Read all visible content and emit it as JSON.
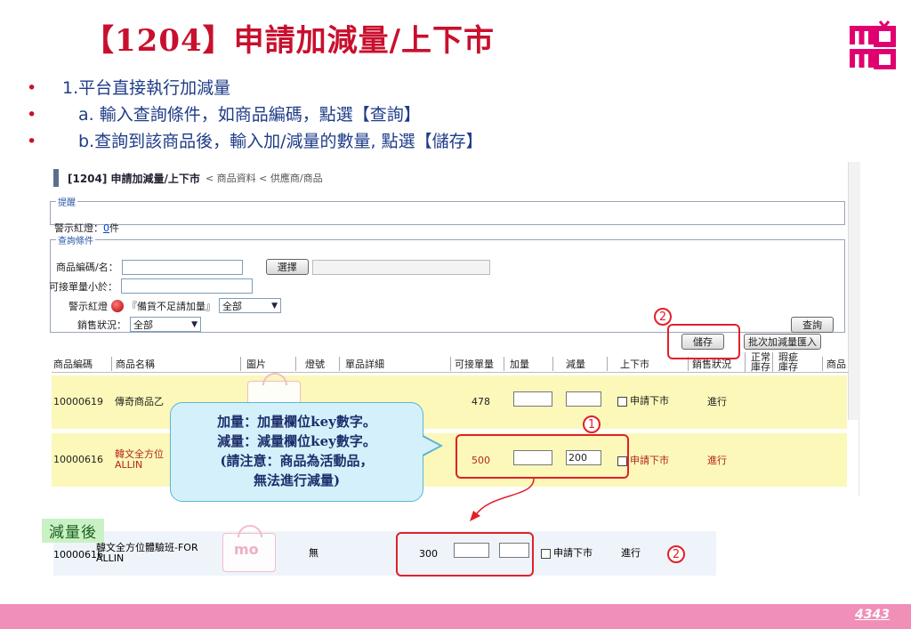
{
  "slide": {
    "title": "【1204】申請加減量/上下市",
    "logo_text": "momo",
    "page_number": "4343"
  },
  "bullets": [
    {
      "marker": "•",
      "text": "1.平台直接執行加減量"
    },
    {
      "marker": "•",
      "text": "a. 輸入查詢條件，如商品編碼，點選【查詢】"
    },
    {
      "marker": "•",
      "text": "b.查詢到該商品後，輸入加/減量的數量, 點選【儲存】"
    }
  ],
  "screen": {
    "title": "[1204] 申請加減量/上下市",
    "breadcrumb": "< 商品資料 < 供應商/商品",
    "remind": {
      "legend": "提醒",
      "label": "警示紅燈：",
      "count": "0",
      "unit": "件"
    },
    "query": {
      "legend": "查詢條件",
      "product_label": "商品編碼/名：",
      "select_button": "選擇",
      "qty_label": "可接單量小於：",
      "warn_label": "警示紅燈",
      "warn_note": "『備貨不足請加量』",
      "warn_select": "全部",
      "sales_label": "銷售狀況：",
      "sales_select": "全部",
      "query_button": "查詢"
    },
    "actions": {
      "save_button": "儲存",
      "batch_button": "批次加減量匯入"
    },
    "columns": [
      "商品編碼",
      "商品名稱",
      "圖片",
      "燈號",
      "單品詳細",
      "可接單量",
      "加量",
      "減量",
      "上下市",
      "銷售狀況",
      "正常庫存",
      "瑕疵庫存",
      "商品"
    ],
    "rows": [
      {
        "code": "10000619",
        "name": "傳奇商品乙",
        "qty": "478",
        "add": "",
        "sub": "",
        "delist": "申請下市",
        "status": "進行"
      },
      {
        "code": "10000616",
        "name": "韓文全方位",
        "name2": "ALLIN",
        "qty": "500",
        "add": "",
        "sub": "200",
        "delist": "申請下市",
        "status": "進行"
      }
    ]
  },
  "callout": {
    "line1": "加量：加量欄位key數字。",
    "line2": "減量：減量欄位key數字。",
    "line3": "(請注意：商品為活動品，",
    "line4": "無法進行減量)"
  },
  "markers": {
    "one": "1",
    "two": "2"
  },
  "after": {
    "label": "減量後",
    "code": "10000616",
    "name": "韓文全方位體驗班-FOR",
    "name2": "ALLIN",
    "light": "無",
    "qty": "300",
    "delist": "申請下市",
    "status": "進行"
  }
}
